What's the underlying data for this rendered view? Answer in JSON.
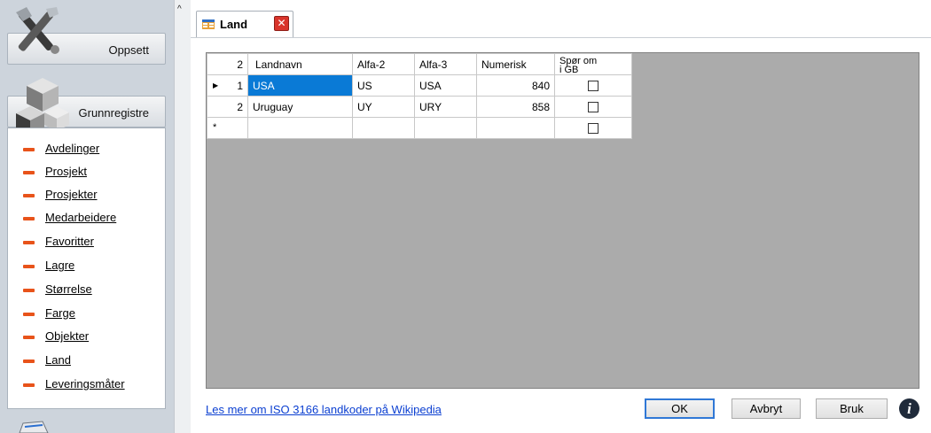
{
  "sidebar": {
    "categories": [
      {
        "label": "Oppsett",
        "icon": "tools-icon"
      },
      {
        "label": "Grunnregistre",
        "icon": "cubes-icon"
      }
    ],
    "items": [
      {
        "label": "Avdelinger"
      },
      {
        "label": "Prosjekt"
      },
      {
        "label": "Prosjekter"
      },
      {
        "label": "Medarbeidere"
      },
      {
        "label": "Favoritter"
      },
      {
        "label": "Lagre"
      },
      {
        "label": "Størrelse"
      },
      {
        "label": "Farge"
      },
      {
        "label": "Objekter"
      },
      {
        "label": "Land"
      },
      {
        "label": "Leveringsmåter"
      }
    ],
    "bullet_color": "#e8531a"
  },
  "tab": {
    "title": "Land",
    "close_glyph": "✕"
  },
  "grid": {
    "row_count": "2",
    "columns": [
      "Landnavn",
      "Alfa-2",
      "Alfa-3",
      "Numerisk",
      "Spør om\ni GB"
    ],
    "rows": [
      {
        "num": "1",
        "landnavn": "USA",
        "alfa2": "US",
        "alfa3": "USA",
        "numerisk": "840",
        "spor_om_i_gb": false,
        "current": true
      },
      {
        "num": "2",
        "landnavn": "Uruguay",
        "alfa2": "UY",
        "alfa3": "URY",
        "numerisk": "858",
        "spor_om_i_gb": false,
        "current": false
      }
    ],
    "new_row_marker": "*",
    "current_row_marker": "▶",
    "selection_color": "#0a7ad6"
  },
  "footer": {
    "link": "Les mer om ISO 3166 landkoder på Wikipedia",
    "ok": "OK",
    "avbryt": "Avbryt",
    "bruk": "Bruk",
    "info_glyph": "i"
  }
}
